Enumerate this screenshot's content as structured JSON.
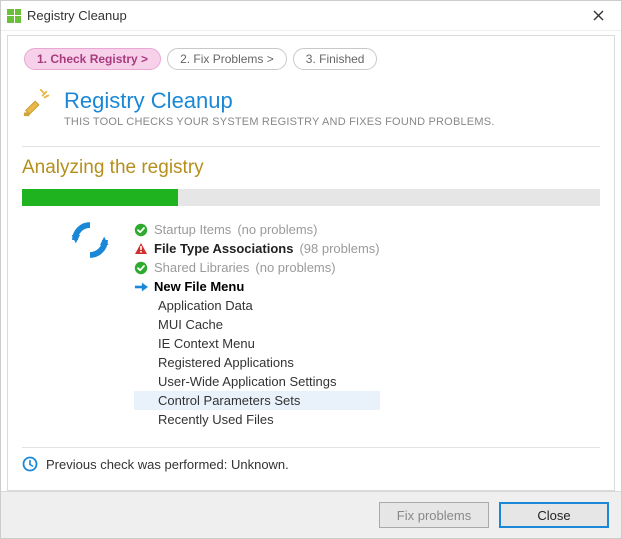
{
  "window": {
    "title": "Registry Cleanup"
  },
  "steps": [
    {
      "label": "1. Check Registry >",
      "active": true
    },
    {
      "label": "2. Fix Problems >",
      "active": false
    },
    {
      "label": "3. Finished",
      "active": false
    }
  ],
  "header": {
    "title": "Registry Cleanup",
    "subtitle": "THIS TOOL CHECKS YOUR SYSTEM REGISTRY AND FIXES FOUND PROBLEMS."
  },
  "status": {
    "heading": "Analyzing the registry",
    "progress_percent": 27
  },
  "scan": [
    {
      "state": "done",
      "label": "Startup Items",
      "extra": "(no problems)"
    },
    {
      "state": "error",
      "label": "File Type Associations",
      "extra": "(98 problems)"
    },
    {
      "state": "done",
      "label": "Shared Libraries",
      "extra": "(no problems)"
    },
    {
      "state": "current",
      "label": "New File Menu",
      "extra": ""
    },
    {
      "state": "pending",
      "label": "Application Data"
    },
    {
      "state": "pending",
      "label": "MUI Cache"
    },
    {
      "state": "pending",
      "label": "IE Context Menu"
    },
    {
      "state": "pending",
      "label": "Registered Applications"
    },
    {
      "state": "pending",
      "label": "User-Wide Application Settings"
    },
    {
      "state": "pending",
      "label": "Control Parameters Sets",
      "highlight": true
    },
    {
      "state": "pending",
      "label": "Recently Used Files"
    }
  ],
  "previous_check": {
    "label": "Previous check was performed: Unknown."
  },
  "footer": {
    "fix_label": "Fix problems",
    "close_label": "Close"
  },
  "colors": {
    "accent_blue": "#1a88d6",
    "accent_pink": "#f7d1ea",
    "progress_green": "#1fb41f",
    "title_gold": "#b58f1c"
  }
}
